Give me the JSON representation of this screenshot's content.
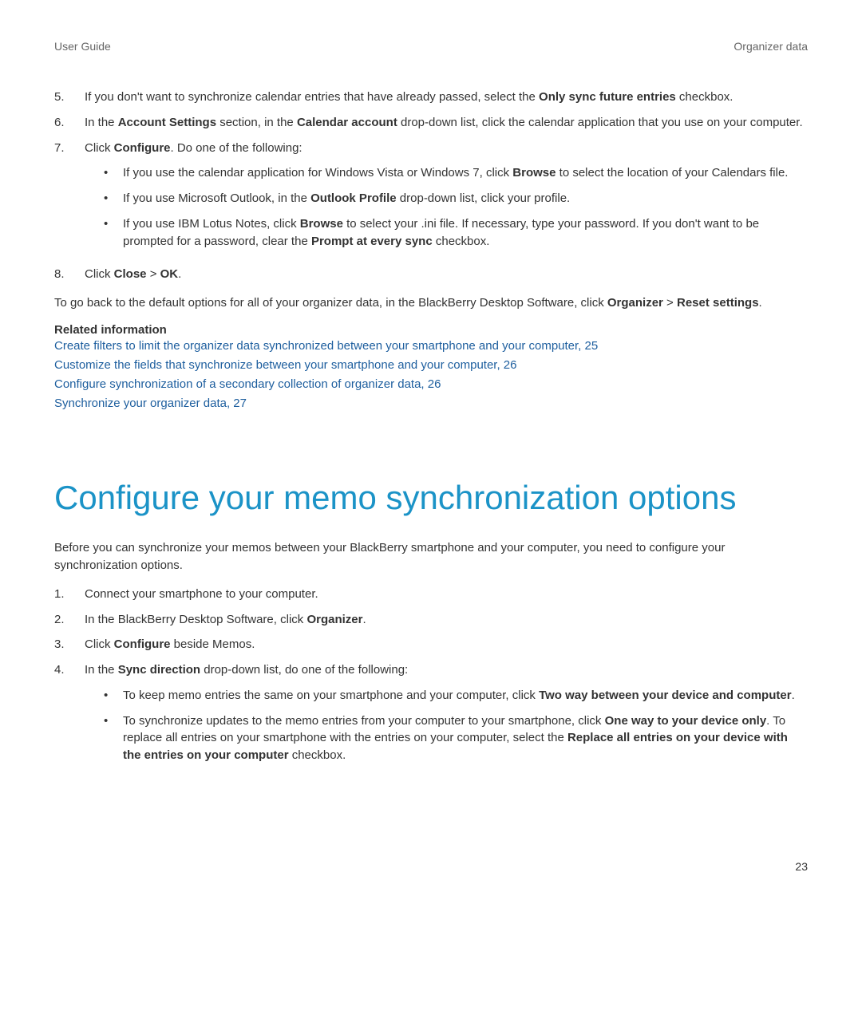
{
  "header": {
    "left": "User Guide",
    "right": "Organizer data"
  },
  "topList": {
    "items": [
      {
        "n": "5.",
        "segments": [
          {
            "t": "If you don't want to synchronize calendar entries that have already passed, select the "
          },
          {
            "t": "Only sync future entries",
            "b": true
          },
          {
            "t": " checkbox."
          }
        ]
      },
      {
        "n": "6.",
        "segments": [
          {
            "t": "In the "
          },
          {
            "t": "Account Settings",
            "b": true
          },
          {
            "t": " section, in the "
          },
          {
            "t": "Calendar account",
            "b": true
          },
          {
            "t": " drop-down list, click the calendar application that you use on your computer."
          }
        ]
      },
      {
        "n": "7.",
        "segments": [
          {
            "t": "Click "
          },
          {
            "t": "Configure",
            "b": true
          },
          {
            "t": ". Do one of the following:"
          }
        ],
        "sub": [
          [
            {
              "t": "If you use the calendar application for Windows Vista or Windows 7, click "
            },
            {
              "t": "Browse",
              "b": true
            },
            {
              "t": " to select the location of your Calendars file."
            }
          ],
          [
            {
              "t": "If you use Microsoft Outlook, in the "
            },
            {
              "t": "Outlook Profile",
              "b": true
            },
            {
              "t": " drop-down list, click your profile."
            }
          ],
          [
            {
              "t": "If you use IBM Lotus Notes, click "
            },
            {
              "t": "Browse",
              "b": true
            },
            {
              "t": " to select your .ini file. If necessary, type your password. If you don't want to be prompted for a password, clear the "
            },
            {
              "t": "Prompt at every sync",
              "b": true
            },
            {
              "t": " checkbox."
            }
          ]
        ]
      },
      {
        "n": "8.",
        "segments": [
          {
            "t": "Click "
          },
          {
            "t": "Close",
            "b": true
          },
          {
            "t": " > "
          },
          {
            "t": "OK",
            "b": true
          },
          {
            "t": "."
          }
        ]
      }
    ]
  },
  "defaultPara": [
    {
      "t": "To go back to the default options for all of your organizer data, in the BlackBerry Desktop Software, click "
    },
    {
      "t": "Organizer",
      "b": true
    },
    {
      "t": " > "
    },
    {
      "t": "Reset settings",
      "b": true
    },
    {
      "t": "."
    }
  ],
  "related": {
    "heading": "Related information",
    "links": [
      {
        "text": "Create filters to limit the organizer data synchronized between your smartphone and your computer,",
        "page": " 25"
      },
      {
        "text": "Customize the fields that synchronize between your smartphone and your computer,",
        "page": " 26"
      },
      {
        "text": "Configure synchronization of a secondary collection of organizer data,",
        "page": " 26"
      },
      {
        "text": "Synchronize your organizer data,",
        "page": " 27"
      }
    ]
  },
  "sectionTitle": "Configure your memo synchronization options",
  "introPara": "Before you can synchronize your memos between your BlackBerry smartphone and your computer, you need to configure your synchronization options.",
  "bottomList": {
    "items": [
      {
        "n": "1.",
        "segments": [
          {
            "t": "Connect your smartphone to your computer."
          }
        ]
      },
      {
        "n": "2.",
        "segments": [
          {
            "t": "In the BlackBerry Desktop Software, click "
          },
          {
            "t": "Organizer",
            "b": true
          },
          {
            "t": "."
          }
        ]
      },
      {
        "n": "3.",
        "segments": [
          {
            "t": "Click "
          },
          {
            "t": "Configure",
            "b": true
          },
          {
            "t": " beside Memos."
          }
        ]
      },
      {
        "n": "4.",
        "segments": [
          {
            "t": "In the "
          },
          {
            "t": "Sync direction",
            "b": true
          },
          {
            "t": " drop-down list, do one of the following:"
          }
        ],
        "sub": [
          [
            {
              "t": "To keep memo entries the same on your smartphone and your computer, click "
            },
            {
              "t": "Two way between your device and computer",
              "b": true
            },
            {
              "t": "."
            }
          ],
          [
            {
              "t": "To synchronize updates to the memo entries from your computer to your smartphone, click "
            },
            {
              "t": "One way to your device only",
              "b": true
            },
            {
              "t": ". To replace all entries on your smartphone with the entries on your computer, select the "
            },
            {
              "t": "Replace all entries on your device with the entries on your computer",
              "b": true
            },
            {
              "t": " checkbox."
            }
          ]
        ]
      }
    ]
  },
  "pageNumber": "23"
}
